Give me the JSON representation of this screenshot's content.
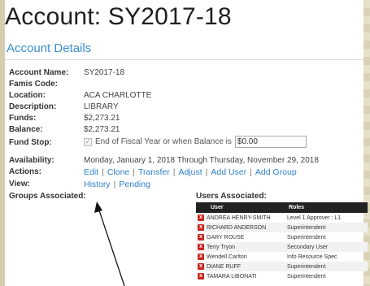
{
  "page": {
    "title": "Account: SY2017-18",
    "section": "Account Details"
  },
  "details": [
    {
      "label": "Account Name:",
      "value": "SY2017-18"
    },
    {
      "label": "Famis Code:",
      "value": ""
    },
    {
      "label": "Location:",
      "value": "ACA CHARLOTTE"
    },
    {
      "label": "Description:",
      "value": "LIBRARY"
    },
    {
      "label": "Funds:",
      "value": "$2,273.21"
    },
    {
      "label": "Balance:",
      "value": "$2,273.21"
    }
  ],
  "fund_stop": {
    "label": "Fund Stop:",
    "checkbox_checked": true,
    "text": "End of Fiscal Year or when Balance is",
    "amount": "$0.00"
  },
  "availability": {
    "label": "Availability:",
    "value": "Monday, January 1, 2018 Through Thursday, November 29, 2018"
  },
  "actions": {
    "label": "Actions:",
    "links": [
      "Edit",
      "Clone",
      "Transfer",
      "Adjust",
      "Add User",
      "Add Group"
    ]
  },
  "view": {
    "label": "View:",
    "links": [
      "History",
      "Pending"
    ]
  },
  "groups": {
    "title": "Groups Associated:"
  },
  "users": {
    "title": "Users Associated:",
    "columns": [
      "User",
      "Roles"
    ],
    "rows": [
      {
        "user": "ANDREA HENRY-SMITH",
        "role": "Level 1 Approver : L1"
      },
      {
        "user": "RICHARD ANDERSON",
        "role": "Superintendent"
      },
      {
        "user": "GARY ROUSE",
        "role": "Superintendent"
      },
      {
        "user": "Terry Tryon",
        "role": "Secondary User"
      },
      {
        "user": "Wendell Carlton",
        "role": "Info Resource Spec"
      },
      {
        "user": "DIANE RUFF",
        "role": "Superintendent"
      },
      {
        "user": "TAMARA LIBONATI",
        "role": "Superintendent"
      }
    ],
    "delete_glyph": "x"
  },
  "colors": {
    "link": "#2f80c9",
    "section": "#3a8fd1",
    "delete": "#c8261f",
    "table_header": "#222222"
  }
}
